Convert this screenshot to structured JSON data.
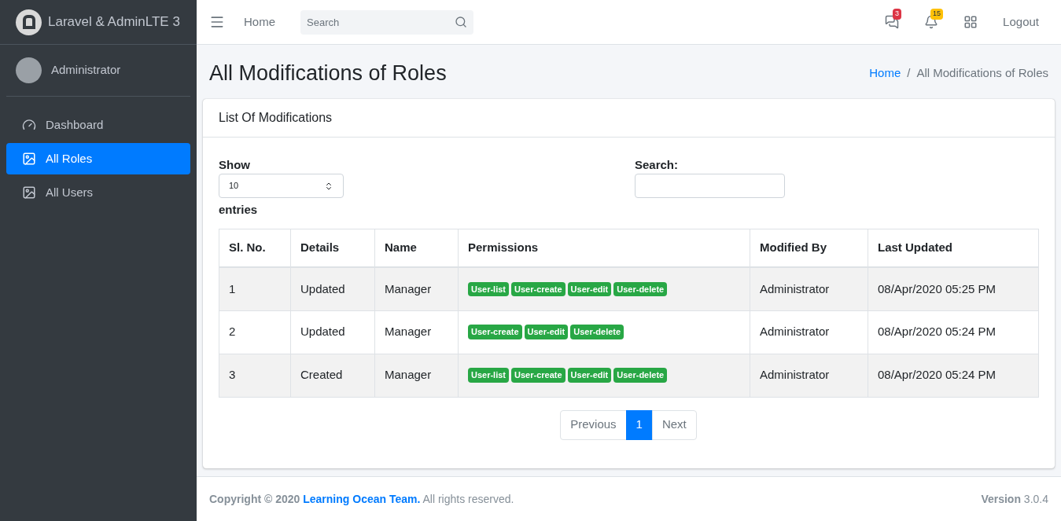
{
  "brand": {
    "title": "Laravel & AdminLTE 3"
  },
  "user": {
    "name": "Administrator"
  },
  "sidebar": {
    "items": [
      {
        "label": "Dashboard",
        "kind": "dashboard",
        "selected": false
      },
      {
        "label": "All Roles",
        "kind": "image",
        "selected": true
      },
      {
        "label": "All Users",
        "kind": "image",
        "selected": false
      }
    ]
  },
  "navbar": {
    "home": "Home",
    "search": {
      "placeholder": "Search"
    },
    "messages_badge": "3",
    "notifications_badge": "15",
    "logout": "Logout"
  },
  "page": {
    "title": "All Modifications of Roles",
    "breadcrumb_separator": "/",
    "breadcrumb": [
      {
        "label": "Home",
        "link": true
      },
      {
        "label": "All Modifications of Roles",
        "link": false
      }
    ]
  },
  "card": {
    "title": "List Of Modifications",
    "show_label": "Show",
    "page_size": "10",
    "entries_label": "entries",
    "search_label": "Search:"
  },
  "table": {
    "columns": [
      "Sl. No.",
      "Details",
      "Name",
      "Permissions",
      "Modified By",
      "Last Updated"
    ],
    "rows": [
      {
        "no": "1",
        "details": "Updated",
        "name": "Manager",
        "permissions": [
          "User-list",
          "User-create",
          "User-edit",
          "User-delete"
        ],
        "modified_by": "Administrator",
        "last_updated": "08/Apr/2020 05:25 PM"
      },
      {
        "no": "2",
        "details": "Updated",
        "name": "Manager",
        "permissions": [
          "User-create",
          "User-edit",
          "User-delete"
        ],
        "modified_by": "Administrator",
        "last_updated": "08/Apr/2020 05:24 PM"
      },
      {
        "no": "3",
        "details": "Created",
        "name": "Manager",
        "permissions": [
          "User-list",
          "User-create",
          "User-edit",
          "User-delete"
        ],
        "modified_by": "Administrator",
        "last_updated": "08/Apr/2020 05:24 PM"
      }
    ]
  },
  "pagination": [
    {
      "label": "Previous",
      "selected": false
    },
    {
      "label": "1",
      "selected": true
    },
    {
      "label": "Next",
      "selected": false
    }
  ],
  "footer": {
    "copyright": "Copyright © 2020",
    "team": "Learning Ocean Team.",
    "rights": "All rights reserved.",
    "version": "**Version** 3.0.4"
  }
}
